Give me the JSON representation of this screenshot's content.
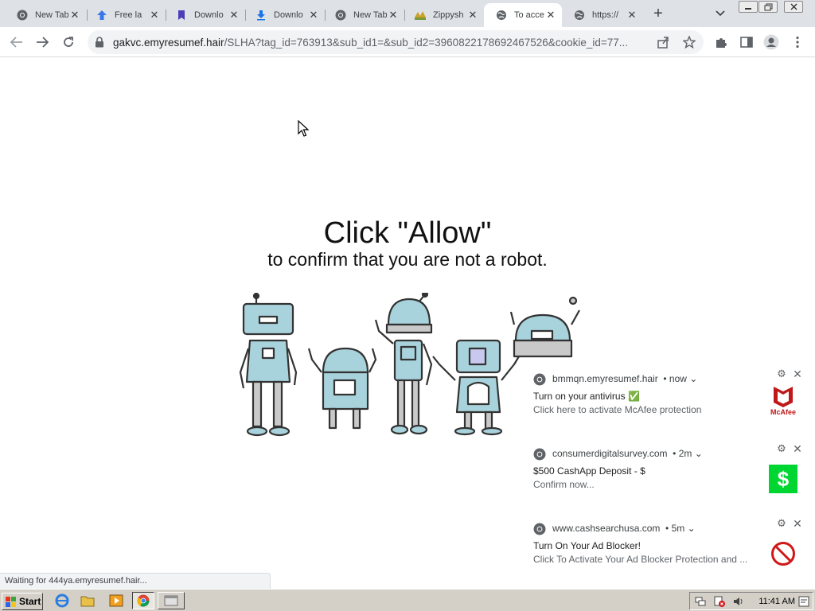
{
  "browser": {
    "tabs": [
      {
        "title": "New Tab",
        "icon": "chrome-icon"
      },
      {
        "title": "Free la",
        "icon": "upload-arrow-icon"
      },
      {
        "title": "Downlo",
        "icon": "bookmark-icon"
      },
      {
        "title": "Downlo",
        "icon": "download-icon"
      },
      {
        "title": "New Tab",
        "icon": "chrome-icon"
      },
      {
        "title": "Zippysh",
        "icon": "zippyshare-icon"
      },
      {
        "title": "To acce",
        "icon": "globe-icon",
        "active": true
      },
      {
        "title": "https://",
        "icon": "globe-icon"
      }
    ],
    "url_host": "gakvc.emyresumef.hair",
    "url_path": "/SLHA?tag_id=763913&sub_id1=&sub_id2=3960822178692467526&cookie_id=77...",
    "status_text": "Waiting for 444ya.emyresumef.hair..."
  },
  "page": {
    "headline": "Click \"Allow\"",
    "subline": "to confirm that you are not a robot."
  },
  "notifications": [
    {
      "source": "bmmqn.emyresumef.hair",
      "time": "now",
      "title": "Turn on your antivirus ✅",
      "body": "Click here to activate McAfee protection",
      "image": "mcafee-logo",
      "brand_label": "McAfee",
      "color": "#c01818"
    },
    {
      "source": "consumerdigitalsurvey.com",
      "time": "2m",
      "title": "$500 CashApp Deposit -  $",
      "body": "Confirm now...",
      "image": "cashapp-logo",
      "brand_label": "$",
      "color": "#00d632"
    },
    {
      "source": "www.cashsearchusa.com",
      "time": "5m",
      "title": "Turn On Your Ad Blocker!",
      "body": "Click To Activate Your Ad Blocker Protection and ...",
      "image": "no-sign-icon",
      "color": "#d01818"
    }
  ],
  "taskbar": {
    "start_label": "Start",
    "clock": "11:41 AM"
  }
}
